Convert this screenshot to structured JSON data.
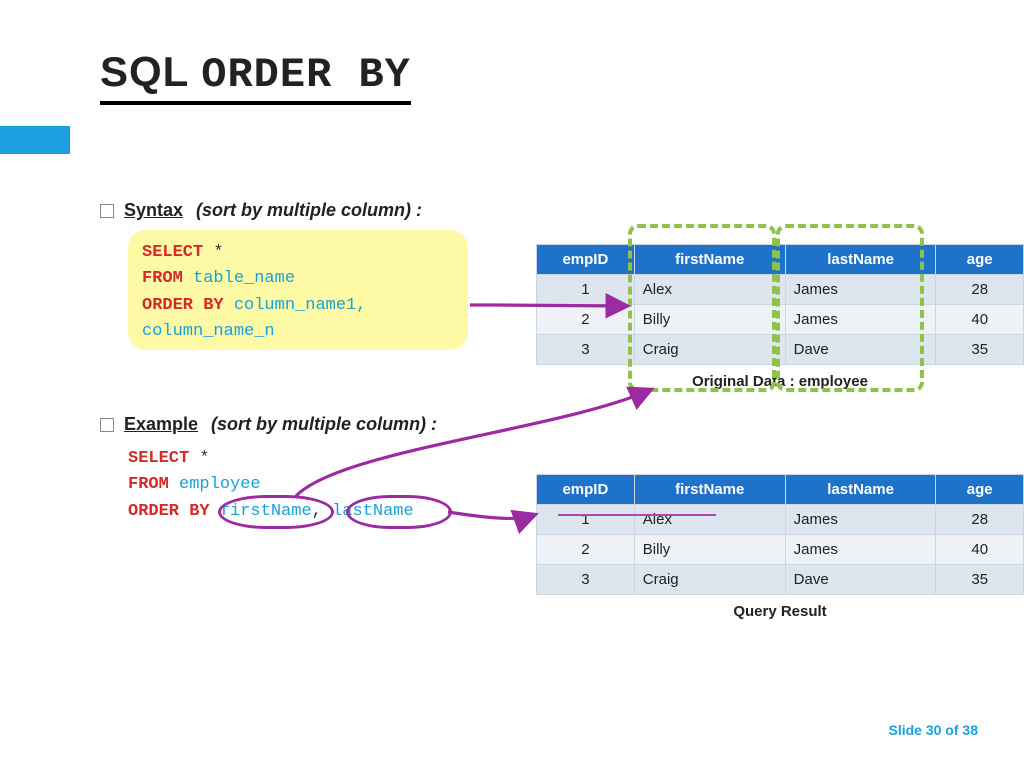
{
  "title_prefix": "SQL ",
  "title_code": "ORDER BY",
  "syntax": {
    "label": "Syntax",
    "desc": "(sort by multiple column) :",
    "code": {
      "select": "SELECT",
      "star": "*",
      "from": "FROM",
      "table": "table_name",
      "orderby": "ORDER BY",
      "col1": "column_name1,",
      "coln": "column_name_n"
    }
  },
  "example": {
    "label": "Example ",
    "desc": "(sort by multiple column) :",
    "code": {
      "select": "SELECT",
      "star": "*",
      "from": "FROM",
      "table": "employee",
      "orderby": "ORDER BY",
      "c1": "firstName",
      "comma": ",",
      "c2": "lastName"
    }
  },
  "tables": {
    "headers": [
      "empID",
      "firstName",
      "lastName",
      "age"
    ],
    "original_caption": "Original Data : employee",
    "result_caption": "Query Result",
    "original": [
      {
        "empID": "1",
        "firstName": "Alex",
        "lastName": "James",
        "age": "28"
      },
      {
        "empID": "2",
        "firstName": "Billy",
        "lastName": "James",
        "age": "40"
      },
      {
        "empID": "3",
        "firstName": "Craig",
        "lastName": "Dave",
        "age": "35"
      }
    ],
    "result": [
      {
        "empID": "1",
        "firstName": "Alex",
        "lastName": "James",
        "age": "28"
      },
      {
        "empID": "2",
        "firstName": "Billy",
        "lastName": "James",
        "age": "40"
      },
      {
        "empID": "3",
        "firstName": "Craig",
        "lastName": "Dave",
        "age": "35"
      }
    ]
  },
  "footer": {
    "prefix": "Slide ",
    "n": "30",
    "of": " of ",
    "total": "38"
  }
}
